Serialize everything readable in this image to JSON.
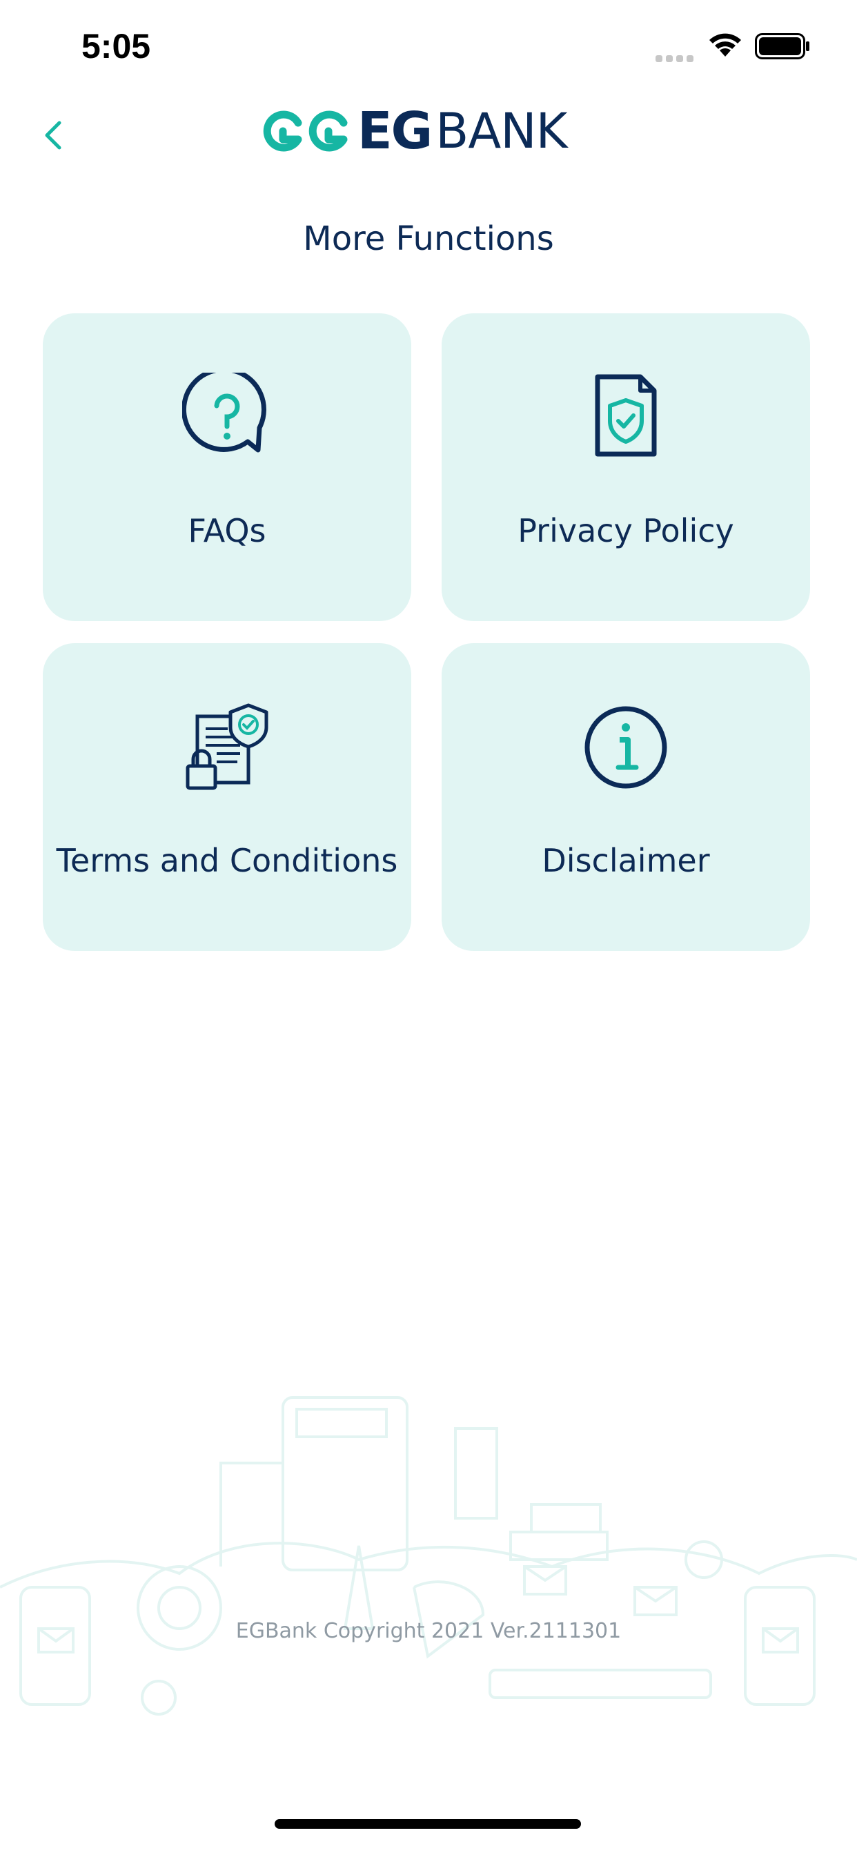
{
  "status_bar": {
    "time": "5:05"
  },
  "header": {
    "back_icon": "chevron-left-icon",
    "logo_text_bold": "EG",
    "logo_text": "BANK"
  },
  "page_title": "More Functions",
  "tiles": [
    {
      "label": "FAQs",
      "icon": "question-bubble-icon"
    },
    {
      "label": "Privacy Policy",
      "icon": "shield-document-icon"
    },
    {
      "label": "Terms and Conditions",
      "icon": "secure-contract-icon"
    },
    {
      "label": "Disclaimer",
      "icon": "info-circle-icon"
    }
  ],
  "footer": {
    "copyright": "EGBank Copyright 2021 Ver.2111301"
  },
  "colors": {
    "accent": "#16b6a3",
    "navy": "#0b2a57",
    "tile_bg": "#e1f5f3"
  }
}
